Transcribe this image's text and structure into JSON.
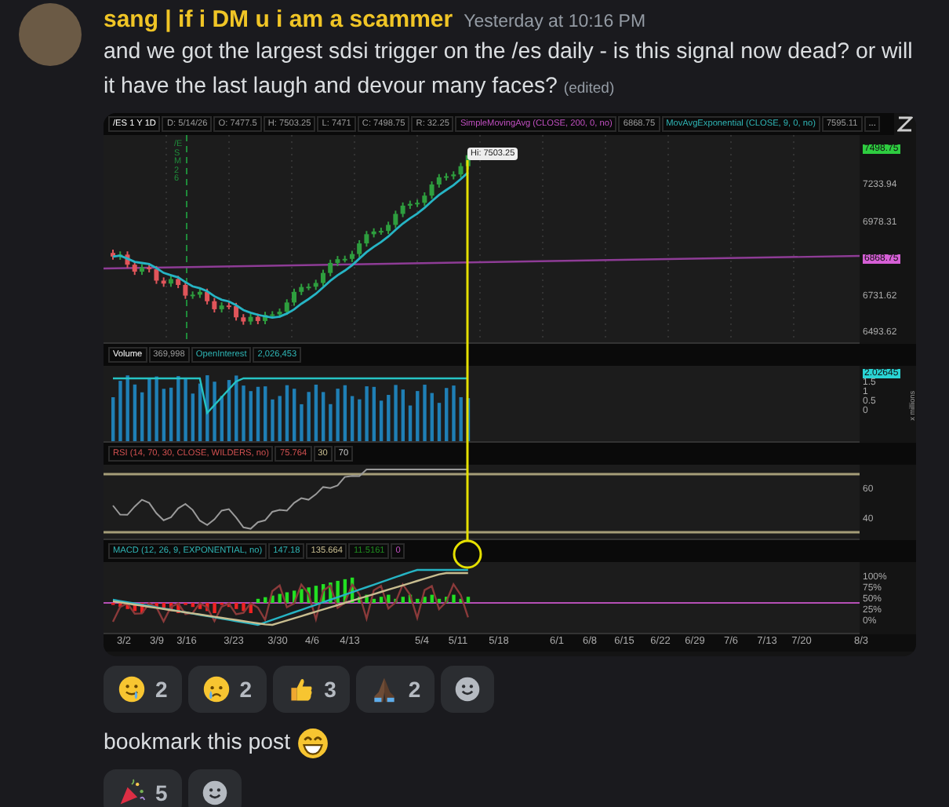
{
  "message": {
    "author": "sang | if i DM u i am a scammer",
    "timestamp": "Yesterday at 10:16 PM",
    "text": "and we got the largest sdsi trigger on the /es daily - is this signal now dead? or will it have the last laugh and devour many faces?",
    "edited": "(edited)"
  },
  "chart": {
    "header": [
      {
        "text": "/ES 1 Y 1D",
        "color": "#ffffff"
      },
      {
        "text": "D: 5/14/26",
        "color": "#9a9a9a"
      },
      {
        "text": "O: 7477.5",
        "color": "#9a9a9a"
      },
      {
        "text": "H: 7503.25",
        "color": "#9a9a9a"
      },
      {
        "text": "L: 7471",
        "color": "#9a9a9a"
      },
      {
        "text": "C: 7498.75",
        "color": "#9a9a9a"
      },
      {
        "text": "R: 32.25",
        "color": "#9a9a9a"
      },
      {
        "text": "SimpleMovingAvg (CLOSE, 200, 0, no)",
        "color": "#c04fc0"
      },
      {
        "text": "6868.75",
        "color": "#9a9a9a"
      },
      {
        "text": "MovAvgExponential (CLOSE, 9, 0, no)",
        "color": "#2fb5b5"
      },
      {
        "text": "7595.11",
        "color": "#9a9a9a"
      },
      {
        "text": "..."
      }
    ],
    "contract_label": "/ESM26",
    "high_tooltip": "Hi: 7503.25",
    "price_axis": [
      {
        "text": "7498.75",
        "kind": "badge",
        "color": "#2ecc40"
      },
      {
        "text": "7233.94",
        "kind": "tick"
      },
      {
        "text": "6978.31",
        "kind": "tick"
      },
      {
        "text": "6868.75",
        "kind": "badge",
        "color": "#d65fd6"
      },
      {
        "text": "6731.62",
        "kind": "tick"
      },
      {
        "text": "6493.62",
        "kind": "tick"
      }
    ],
    "volume_header": [
      {
        "text": "Volume",
        "color": "#ffffff"
      },
      {
        "text": "369,998",
        "color": "#9a9a9a"
      },
      {
        "text": "OpenInterest",
        "color": "#2fb5b5"
      },
      {
        "text": "2,026,453",
        "color": "#2fb5b5"
      }
    ],
    "volume_axis": [
      {
        "text": "2.02645",
        "kind": "badge",
        "color": "#29d3d3"
      },
      {
        "text": "1.5",
        "kind": "tick"
      },
      {
        "text": "1",
        "kind": "tick"
      },
      {
        "text": "0.5",
        "kind": "tick"
      },
      {
        "text": "0",
        "kind": "tick"
      }
    ],
    "volume_unit": "x millions",
    "rsi_header": [
      {
        "text": "RSI (14, 70, 30, CLOSE, WILDERS, no)",
        "color": "#d05050"
      },
      {
        "text": "75.764",
        "color": "#d05050"
      },
      {
        "text": "30",
        "color": "#c8bd90"
      },
      {
        "text": "70"
      }
    ],
    "rsi_axis": [
      "60",
      "40"
    ],
    "macd_header": [
      {
        "text": "MACD (12, 26, 9, EXPONENTIAL, no)",
        "color": "#2fb5b5"
      },
      {
        "text": "147.18",
        "color": "#2fb5b5"
      },
      {
        "text": "135.664",
        "color": "#c8bd90"
      },
      {
        "text": "11.5161",
        "color": "#1f8a1f"
      },
      {
        "text": "0",
        "color": "#c04fc0"
      }
    ],
    "macd_axis": [
      "100%",
      "75%",
      "50%",
      "25%",
      "0%"
    ],
    "dates": [
      "3/2",
      "3/9",
      "3/16",
      "3/23",
      "3/30",
      "4/6",
      "4/13",
      "5/4",
      "5/11",
      "5/18",
      "6/1",
      "6/8",
      "6/15",
      "6/22",
      "6/29",
      "7/6",
      "7/13",
      "7/20",
      "8/3"
    ]
  },
  "reactions": [
    {
      "kind": "smile-tear",
      "count": "2"
    },
    {
      "kind": "crying",
      "count": "2"
    },
    {
      "kind": "thumbs-up",
      "count": "3"
    },
    {
      "kind": "folded-hands",
      "count": "2"
    }
  ],
  "followup": {
    "text": "bookmark this post",
    "kind": "grin"
  },
  "followup_reactions": [
    {
      "kind": "party",
      "count": "5"
    }
  ]
}
